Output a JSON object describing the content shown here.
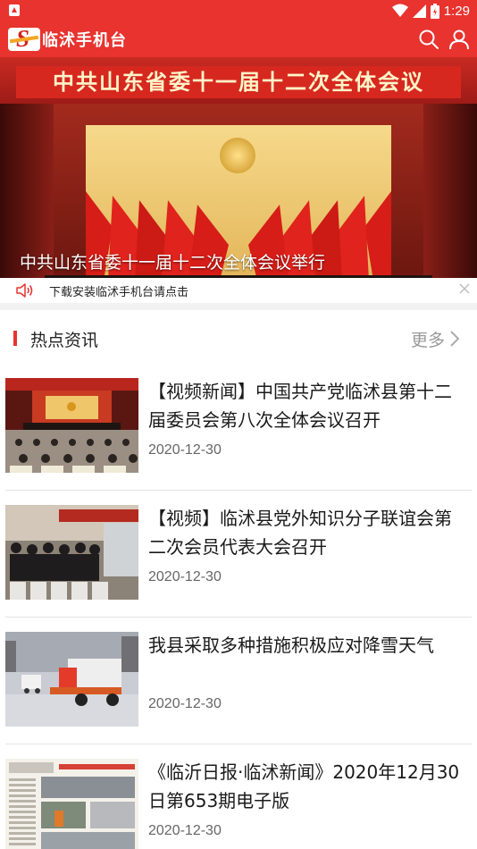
{
  "status_bar": {
    "time": "1:29"
  },
  "app_bar": {
    "title": "临沭手机台"
  },
  "banner": {
    "title": "中共山东省委十一届十二次全体会议",
    "caption": "中共山东省委十一届十二次全体会议举行",
    "slide_count": 5,
    "active_slide": 1
  },
  "notice": {
    "text": "下载安装临沭手机台请点击"
  },
  "section": {
    "title": "热点资讯",
    "more": "更多"
  },
  "news": [
    {
      "headline": "【视频新闻】中国共产党临沭县第十二届委员会第八次全体会议召开",
      "date": "2020-12-30",
      "thumb": "meeting-hall"
    },
    {
      "headline": "【视频】临沭县党外知识分子联谊会第二次会员代表大会召开",
      "date": "2020-12-30",
      "thumb": "audience"
    },
    {
      "headline": "我县采取多种措施积极应对降雪天气",
      "date": "2020-12-30",
      "thumb": "snow-plow"
    },
    {
      "headline": "《临沂日报·临沭新闻》2020年12月30日第653期电子版",
      "date": "2020-12-30",
      "thumb": "newspaper"
    }
  ],
  "colors": {
    "brand_red": "#e8332f",
    "more_gray": "#999999"
  }
}
